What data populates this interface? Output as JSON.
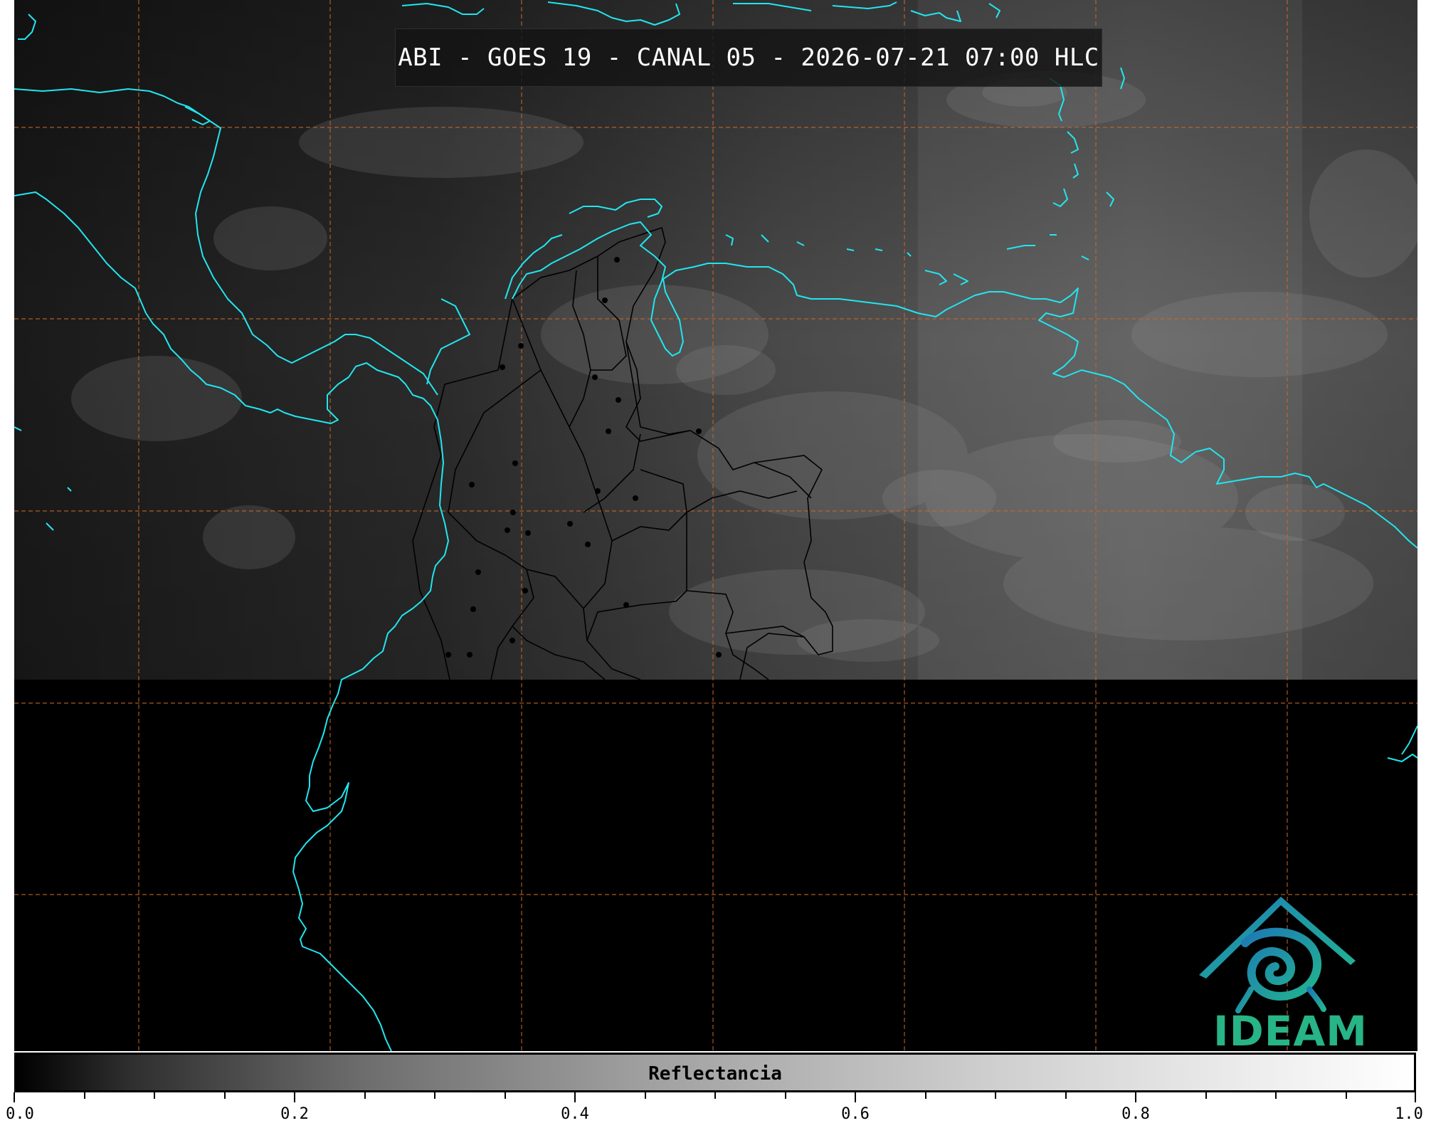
{
  "title": "ABI - GOES 19 - CANAL 05 - 2026-07-21 07:00 HLC",
  "colorbar": {
    "label": "Reflectancia",
    "min": 0.0,
    "max": 1.0,
    "ticks": [
      "0.0",
      "0.2",
      "0.4",
      "0.6",
      "0.8",
      "1.0"
    ],
    "minor_tick_step": 0.05
  },
  "logo": {
    "text": "IDEAM"
  },
  "colors": {
    "coastline": "#22e5ee",
    "gridlines": "#c8692a",
    "borders": "#000000",
    "logo_text": "#27b487",
    "logo_roof": "#1f8fb0",
    "logo_swirl": "#22a98b"
  }
}
